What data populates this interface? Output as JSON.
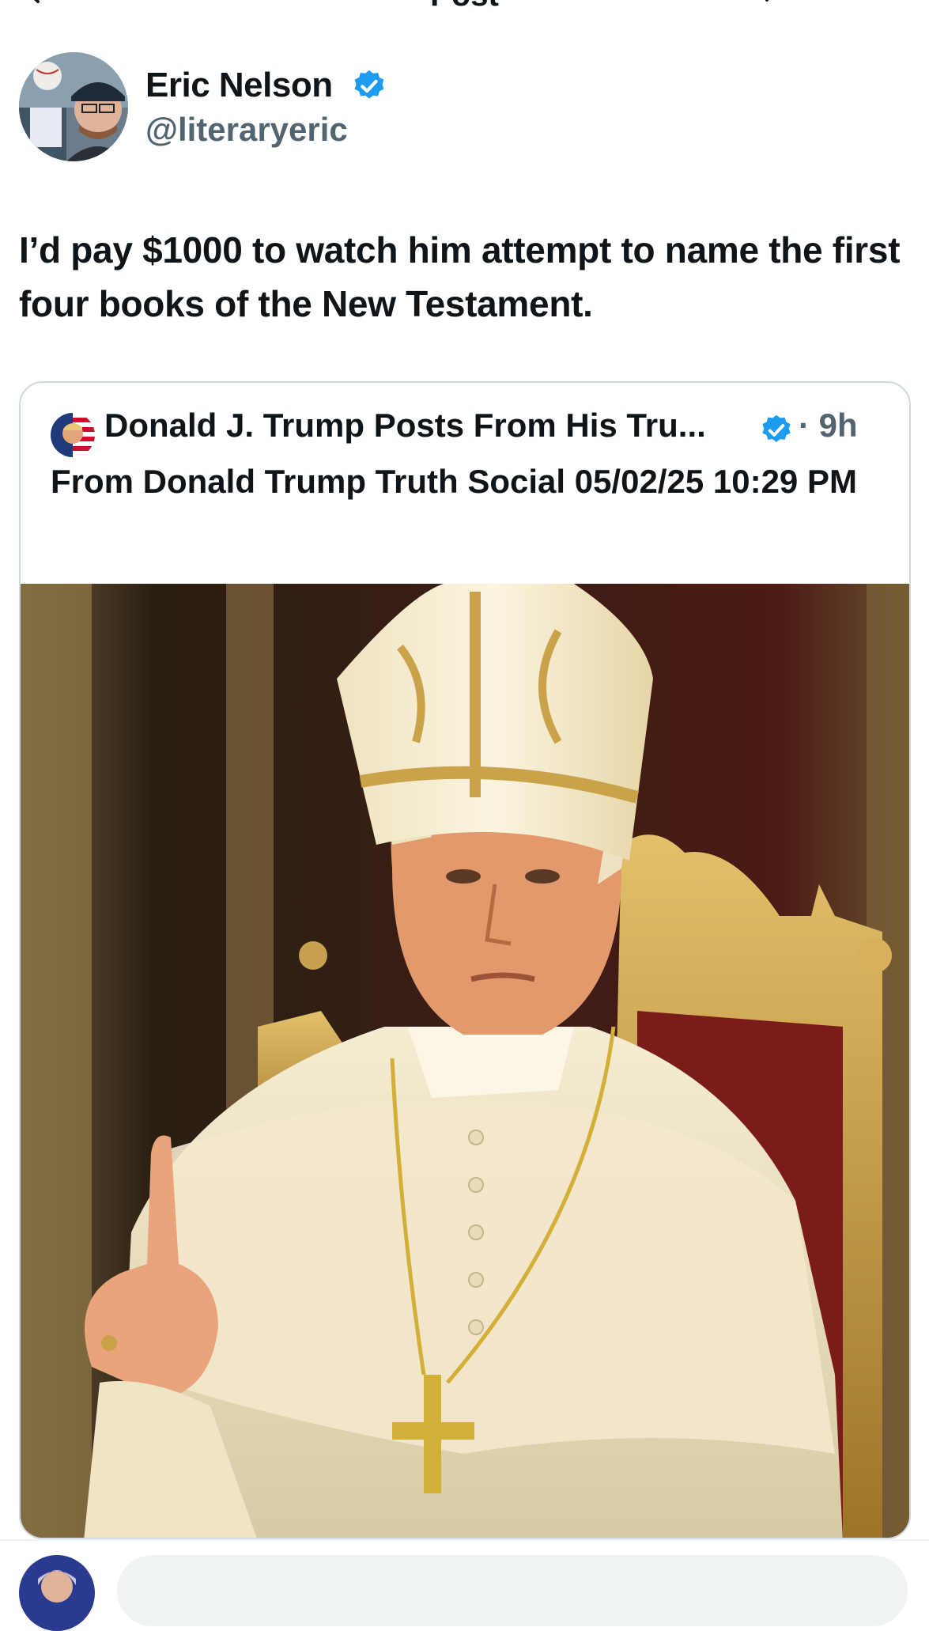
{
  "nav": {
    "title": "Post"
  },
  "author": {
    "name": "Eric Nelson",
    "handle": "@literaryeric",
    "verified": true
  },
  "tweet": {
    "text": "I’d pay $1000 to watch him attempt to name the first four books of the New Testament."
  },
  "quote": {
    "name": "Donald J. Trump Posts From His Tru...",
    "time": "· 9h",
    "verified": true,
    "text": "From Donald Trump Truth Social 05/02/25 10:29 PM",
    "image_icon": "pope-portrait-image"
  },
  "colors": {
    "verified_blue": "#1d9bf0",
    "text_primary": "#0f1419",
    "text_secondary": "#536471",
    "border": "#cfd9de"
  }
}
